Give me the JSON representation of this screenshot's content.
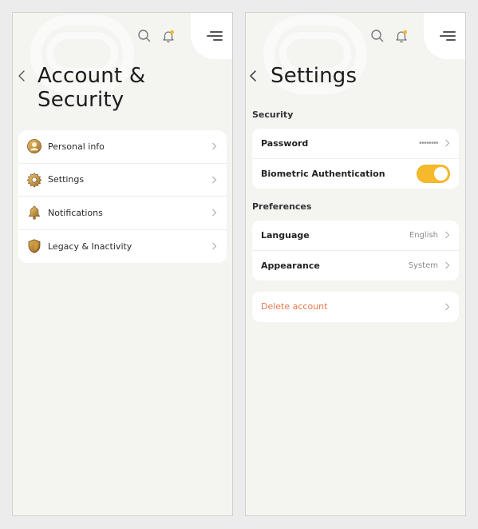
{
  "left_screen": {
    "title_line1": "Account &",
    "title_line2": "Security",
    "icons": [
      "search-icon",
      "bell-icon",
      "menu-icon",
      "back-chevron-icon"
    ],
    "menu_items": [
      {
        "label": "Personal info",
        "icon": "user-avatar-icon"
      },
      {
        "label": "Settings",
        "icon": "gear-icon"
      },
      {
        "label": "Notifications",
        "icon": "bell-icon"
      },
      {
        "label": "Legacy & Inactivity",
        "icon": "shield-icon"
      }
    ]
  },
  "right_screen": {
    "title": "Settings",
    "security_section": {
      "label": "Security",
      "password_label": "Password",
      "password_value": "••••••••",
      "biometric_label": "Biometric Authentication",
      "biometric_enabled": true
    },
    "preferences_section": {
      "label": "Preferences",
      "language_label": "Language",
      "language_value": "English",
      "appearance_label": "Appearance",
      "appearance_value": "System"
    },
    "delete_account_label": "Delete account"
  },
  "colors": {
    "accent": "#f5b92b",
    "notification_dot": "#f5b92b",
    "danger": "#e8744a",
    "screen_bg": "#f4f4f1",
    "card_bg": "#ffffff"
  }
}
